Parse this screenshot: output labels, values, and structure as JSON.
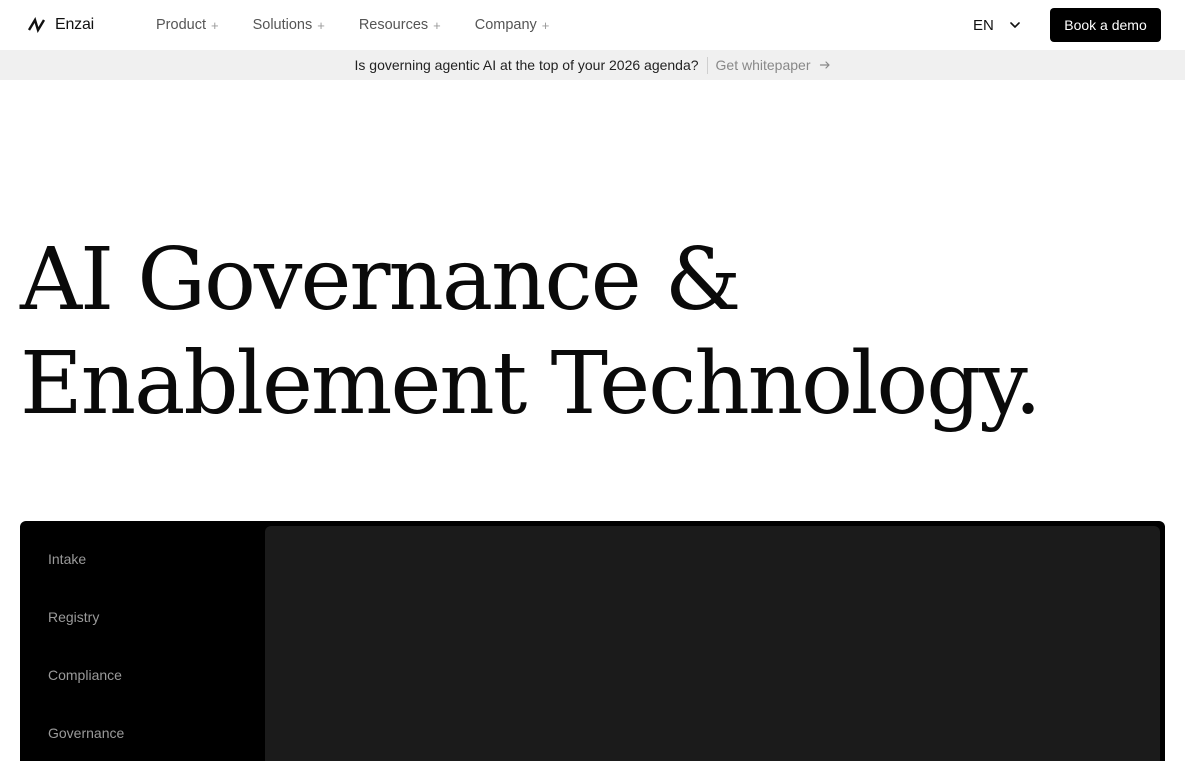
{
  "nav": {
    "brand": {
      "name": "Enzai",
      "icon": "enzai-logo-icon"
    },
    "menu": [
      {
        "label": "Product",
        "icon": "plus-icon"
      },
      {
        "label": "Solutions",
        "icon": "plus-icon"
      },
      {
        "label": "Resources",
        "icon": "plus-icon"
      },
      {
        "label": "Company",
        "icon": "plus-icon"
      }
    ],
    "language": {
      "code": "EN",
      "icon": "chevron-down-icon"
    },
    "cta_label": "Book a demo"
  },
  "banner": {
    "text": "Is governing agentic AI at the top of your 2026 agenda?",
    "link_label": "Get whitepaper",
    "link_icon": "arrow-right-icon"
  },
  "hero": {
    "line1": "AI Governance &",
    "line2": "Enablement Technology."
  },
  "product_panel": {
    "tabs": [
      "Intake",
      "Registry",
      "Compliance",
      "Governance"
    ]
  },
  "colors": {
    "cta_background": "#000000",
    "banner_background": "#f0f0f0",
    "panel_background": "#000000",
    "preview_background": "#1b1b1b"
  }
}
